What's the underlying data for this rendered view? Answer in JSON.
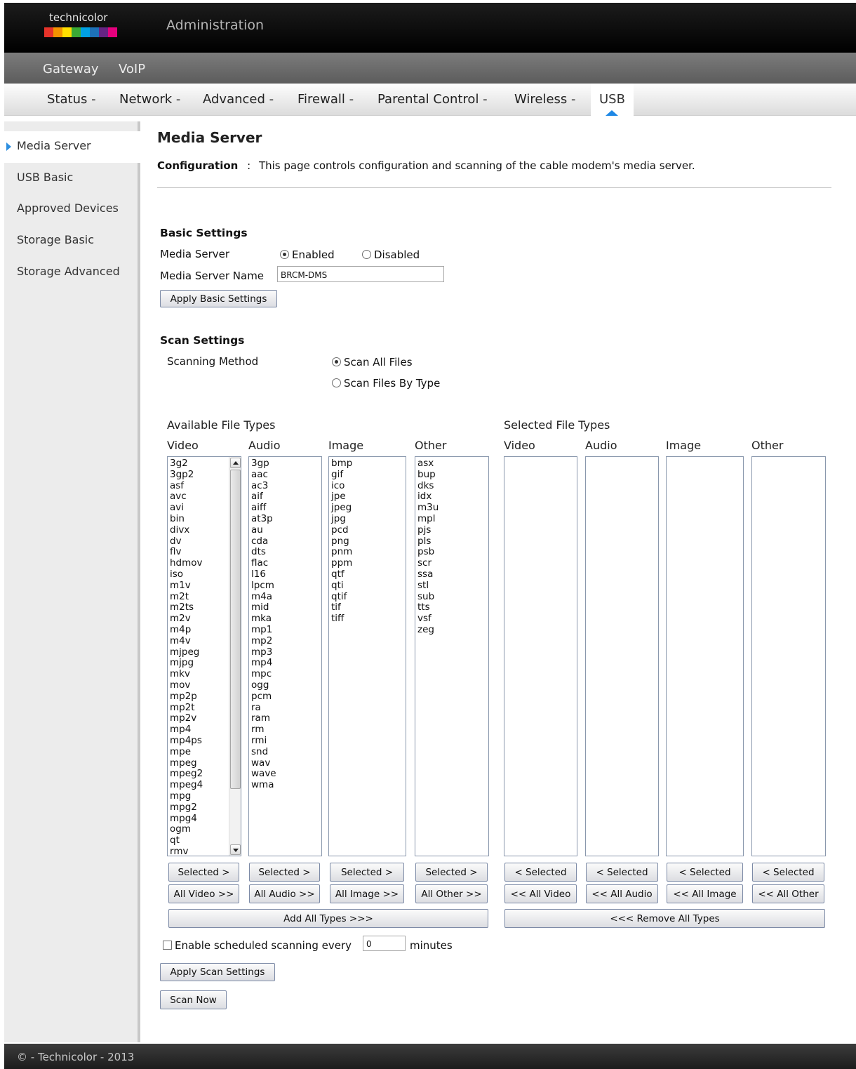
{
  "brand": {
    "logo_text": "technicolor",
    "logo_colors": [
      "#e6332a",
      "#f39200",
      "#ffde00",
      "#3aaa35",
      "#00a0e3",
      "#1d71b8",
      "#662483",
      "#e5007d"
    ]
  },
  "header": {
    "title": "Administration"
  },
  "subnav": [
    "Gateway",
    "VoIP"
  ],
  "tabs": [
    {
      "label": "Status -"
    },
    {
      "label": "Network -"
    },
    {
      "label": "Advanced -"
    },
    {
      "label": "Firewall -"
    },
    {
      "label": "Parental Control -"
    },
    {
      "label": "Wireless -"
    },
    {
      "label": "USB",
      "active": true
    }
  ],
  "sidebar": {
    "items": [
      {
        "label": "Media Server",
        "active": true
      },
      {
        "label": "USB Basic"
      },
      {
        "label": "Approved Devices"
      },
      {
        "label": "Storage Basic"
      },
      {
        "label": "Storage Advanced"
      }
    ]
  },
  "page": {
    "title": "Media Server",
    "config_label": "Configuration",
    "config_sep": ":",
    "config_desc": "This page controls configuration and scanning of the cable modem's media server."
  },
  "basic": {
    "heading": "Basic Settings",
    "server_label": "Media Server",
    "enabled_label": "Enabled",
    "disabled_label": "Disabled",
    "selected": "Enabled",
    "name_label": "Media Server Name",
    "name_value": "BRCM-DMS",
    "apply_label": "Apply Basic Settings"
  },
  "scan": {
    "heading": "Scan Settings",
    "method_label": "Scanning Method",
    "opt_all": "Scan All Files",
    "opt_type": "Scan Files By Type",
    "selected": "Scan All Files",
    "available_label": "Available File Types",
    "selected_types_label": "Selected File Types",
    "columns": [
      "Video",
      "Audio",
      "Image",
      "Other"
    ],
    "video": [
      "3g2",
      "3gp2",
      "asf",
      "avc",
      "avi",
      "bin",
      "divx",
      "dv",
      "flv",
      "hdmov",
      "iso",
      "m1v",
      "m2t",
      "m2ts",
      "m2v",
      "m4p",
      "m4v",
      "mjpeg",
      "mjpg",
      "mkv",
      "mov",
      "mp2p",
      "mp2t",
      "mp2v",
      "mp4",
      "mp4ps",
      "mpe",
      "mpeg",
      "mpeg2",
      "mpeg4",
      "mpg",
      "mpg2",
      "mpg4",
      "ogm",
      "qt",
      "rmv"
    ],
    "audio": [
      "3gp",
      "aac",
      "ac3",
      "aif",
      "aiff",
      "at3p",
      "au",
      "cda",
      "dts",
      "flac",
      "l16",
      "lpcm",
      "m4a",
      "mid",
      "mka",
      "mp1",
      "mp2",
      "mp3",
      "mp4",
      "mpc",
      "ogg",
      "pcm",
      "ra",
      "ram",
      "rm",
      "rmi",
      "snd",
      "wav",
      "wave",
      "wma"
    ],
    "image": [
      "bmp",
      "gif",
      "ico",
      "jpe",
      "jpeg",
      "jpg",
      "pcd",
      "png",
      "pnm",
      "ppm",
      "qtf",
      "qti",
      "qtif",
      "tif",
      "tiff"
    ],
    "other": [
      "asx",
      "bup",
      "dks",
      "idx",
      "m3u",
      "mpl",
      "pjs",
      "pls",
      "psb",
      "scr",
      "ssa",
      "stl",
      "sub",
      "tts",
      "vsf",
      "zeg"
    ],
    "add_selected": "Selected >",
    "remove_selected": "< Selected",
    "add_all": [
      "All Video >>",
      "All Audio >>",
      "All Image >>",
      "All Other >>"
    ],
    "remove_all": [
      "<< All Video",
      "<< All Audio",
      "<< All Image",
      "<< All Other"
    ],
    "add_all_types": "Add All Types >>>",
    "remove_all_types": "<<< Remove All Types",
    "schedule_label": "Enable scheduled scanning every",
    "schedule_value": "0",
    "schedule_unit": "minutes",
    "schedule_checked": false,
    "apply_label": "Apply Scan Settings",
    "scan_now_label": "Scan Now"
  },
  "footer": {
    "text": "© - Technicolor - 2013"
  }
}
